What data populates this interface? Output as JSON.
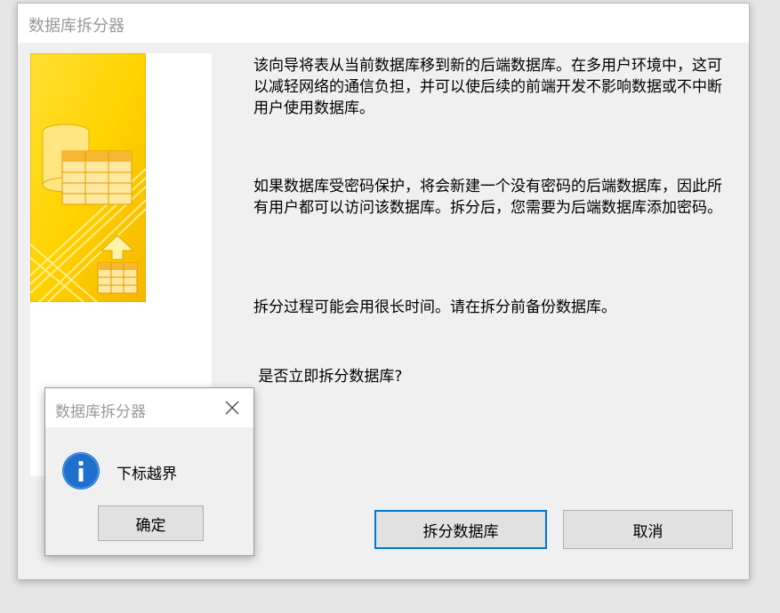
{
  "main_dialog": {
    "title": "数据库拆分器",
    "paragraphs": [
      "该向导将表从当前数据库移到新的后端数据库。在多用户环境中，这可以减轻网络的通信负担，并可以使后续的前端开发不影响数据或不中断用户使用数据库。",
      "如果数据库受密码保护，将会新建一个没有密码的后端数据库，因此所有用户都可以访问该数据库。拆分后，您需要为后端数据库添加密码。",
      "拆分过程可能会用很长时间。请在拆分前备份数据库。",
      " 是否立即拆分数据库?"
    ],
    "split_button_label": "拆分数据库",
    "cancel_button_label": "取消"
  },
  "message_box": {
    "title": "数据库拆分器",
    "message": "下标越界",
    "ok_label": "确定"
  },
  "colors": {
    "accent": "#0078d7",
    "illustration_yellow": "#ffd200",
    "info_blue": "#1f6fce"
  },
  "icons": {
    "illustration": "database-table-illustration",
    "msgbox_icon": "info-icon",
    "close": "close-icon"
  }
}
